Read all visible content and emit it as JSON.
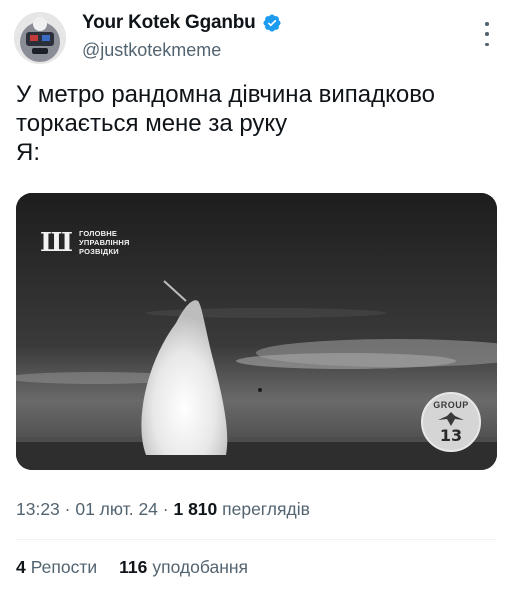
{
  "author": {
    "display_name": "Your Kotek Gganbu",
    "handle": "@justkotekmeme",
    "verified_icon": "verified-badge-icon",
    "avatar_icon": "avatar-image"
  },
  "menu": {
    "more_icon": "more-options-icon"
  },
  "tweet": {
    "text": "У метро рандомна дівчина випадково\nторкається мене за руку\nЯ:"
  },
  "media": {
    "logo_mark": "Ш",
    "logo_lines": [
      "ГОЛОВНЕ",
      "УПРАВЛІННЯ",
      "РОЗВІДКИ"
    ],
    "badge_top": "GROUP",
    "badge_number": "13"
  },
  "meta": {
    "time": "13:23",
    "separator": " · ",
    "date": "01 лют. 24",
    "views_count": "1 810",
    "views_label": " переглядів"
  },
  "stats": {
    "reposts_count": "4",
    "reposts_label": "Репости",
    "likes_count": "116",
    "likes_label": "уподобання"
  },
  "colors": {
    "text_primary": "#0f1419",
    "text_secondary": "#536471",
    "verified_blue": "#1d9bf0",
    "divider": "#eff3f4"
  }
}
